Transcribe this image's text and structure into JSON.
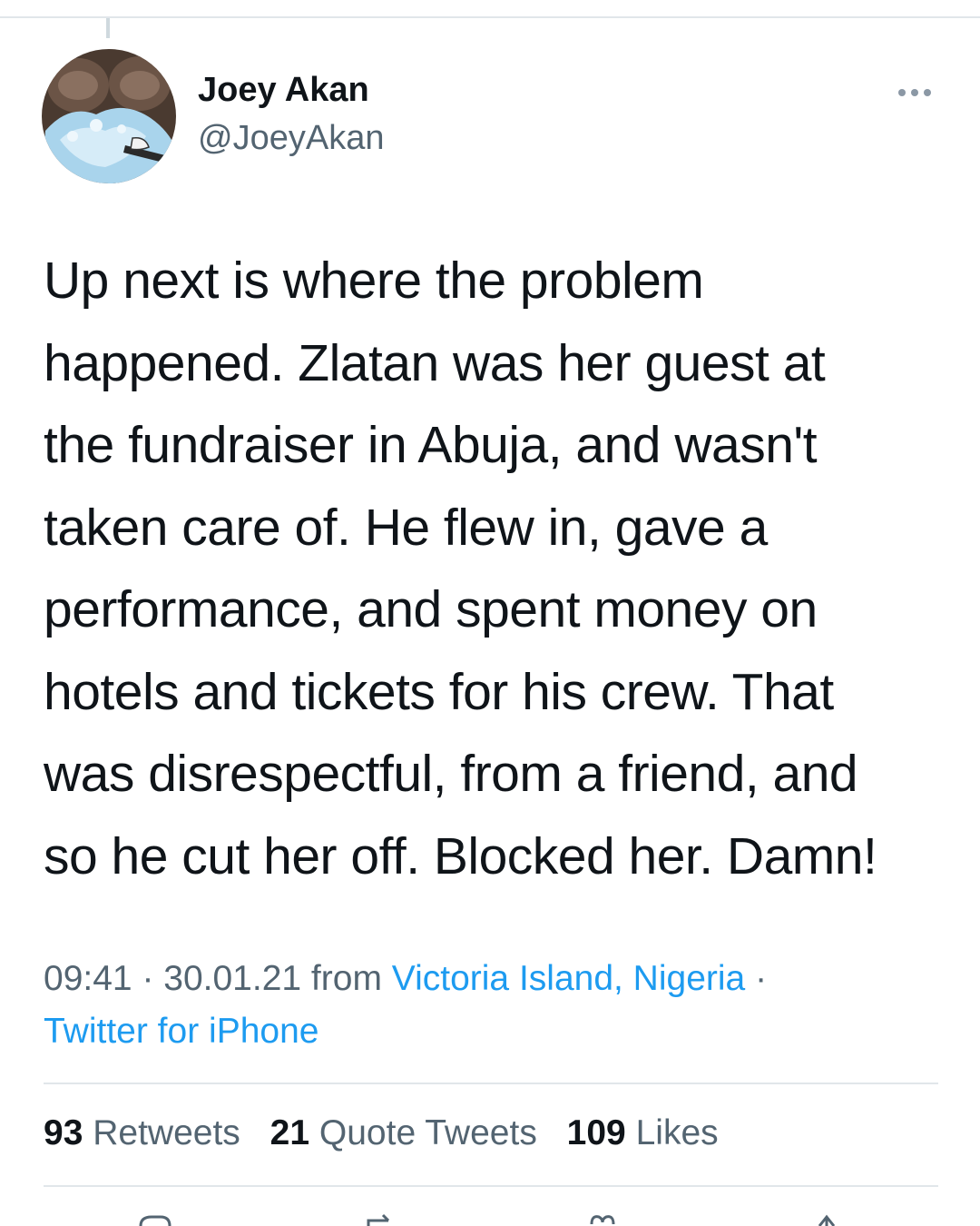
{
  "tweet": {
    "author": {
      "display_name": "Joey Akan",
      "handle": "@JoeyAkan",
      "avatar_icon": "cartoon-avatar-icon"
    },
    "menu_icon": "more-options-icon",
    "text_lines": [
      "Up next is where the problem",
      "happened. Zlatan was her guest at",
      "the fundraiser in Abuja, and wasn't",
      "taken care of. He flew in, gave a",
      "performance, and spent money on",
      "hotels and tickets for his crew. That",
      "was disrespectful, from a friend, and",
      "so he cut her off. Blocked her. Damn!"
    ],
    "meta": {
      "time": "09:41",
      "separator": " · ",
      "date": "30.01.21",
      "from_label": " from ",
      "location": "Victoria Island, Nigeria",
      "separator_end": " ·",
      "source": "Twitter for iPhone"
    },
    "stats": {
      "retweets_count": "93",
      "retweets_label": "Retweets",
      "quotes_count": "21",
      "quotes_label": "Quote Tweets",
      "likes_count": "109",
      "likes_label": "Likes"
    },
    "actions": [
      "reply-icon",
      "retweet-icon",
      "like-icon",
      "share-icon"
    ]
  },
  "colors": {
    "text": "#0f1419",
    "secondary": "#536471",
    "link": "#1d9bf0",
    "divider": "#e1e6ea"
  }
}
